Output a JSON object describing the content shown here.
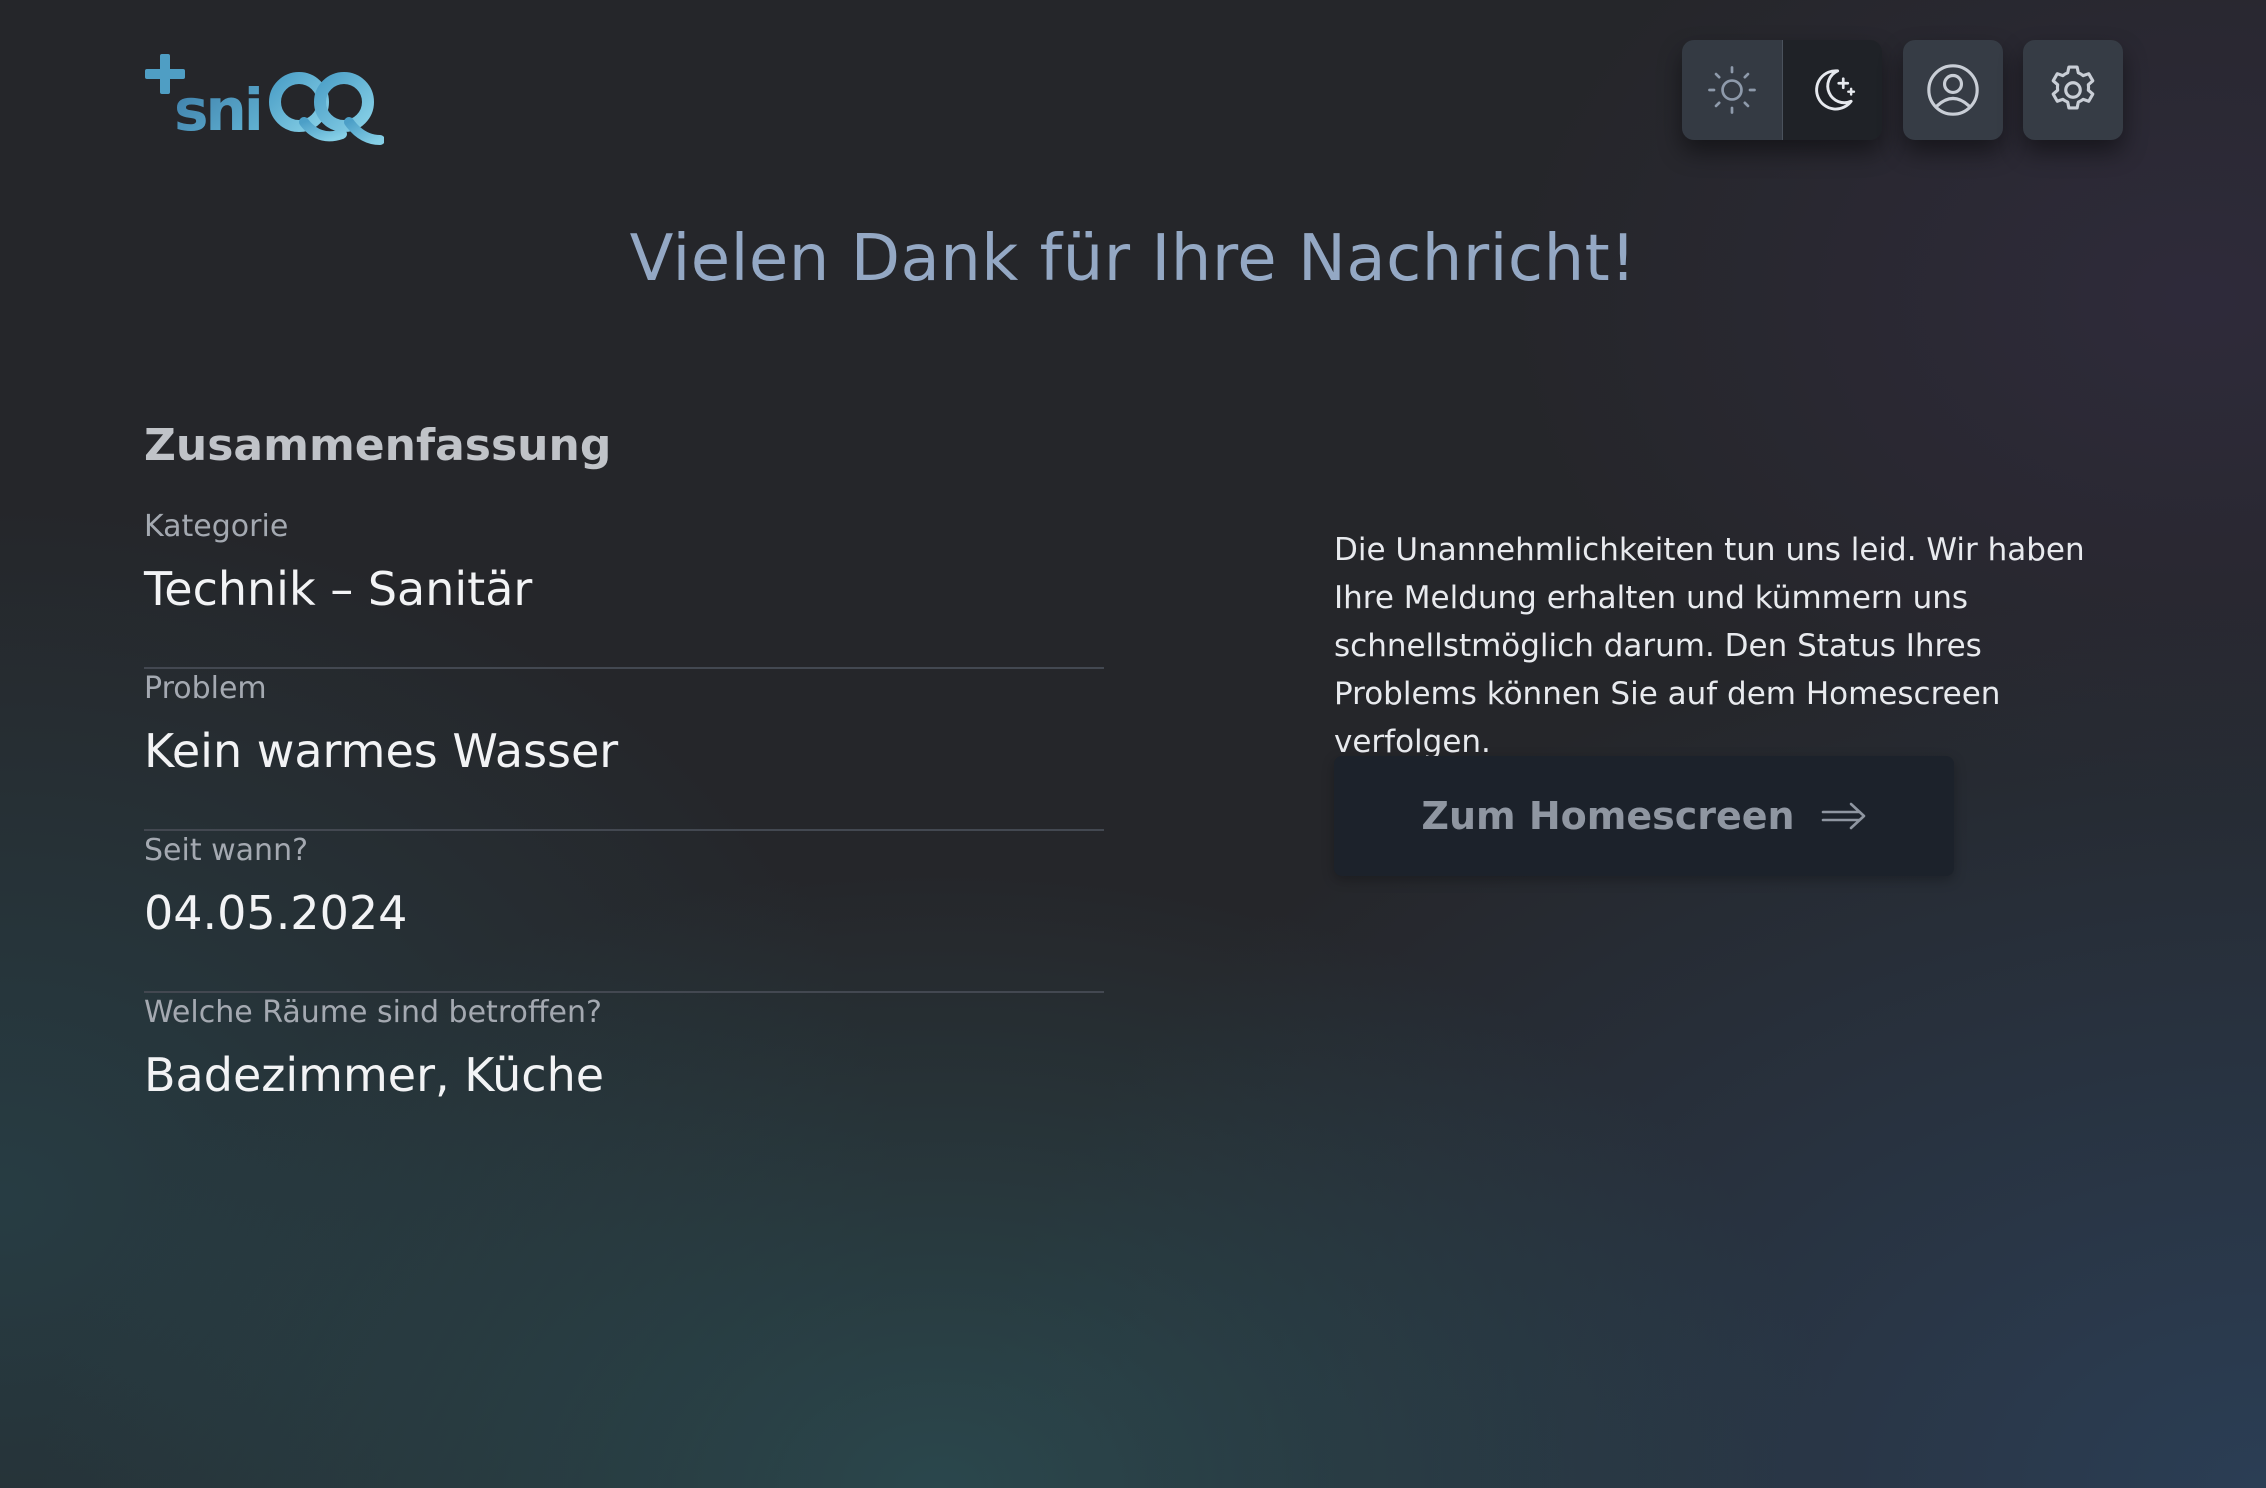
{
  "brand": {
    "logo_text": "sniQQ",
    "colors": {
      "primary": "#3f86a9",
      "accent": "#5fb4d6"
    }
  },
  "header": {
    "theme_toggle": {
      "light_icon": "sun-icon",
      "dark_icon": "moon-stars-icon",
      "active": "dark"
    },
    "profile_icon": "user-circle-icon",
    "settings_icon": "gear-icon"
  },
  "page": {
    "title": "Vielen Dank für Ihre Nachricht!"
  },
  "summary": {
    "heading": "Zusammenfassung",
    "items": [
      {
        "label": "Kategorie",
        "value": "Technik – Sanitär"
      },
      {
        "label": "Problem",
        "value": "Kein warmes Wasser"
      },
      {
        "label": "Seit wann?",
        "value": "04.05.2024"
      },
      {
        "label": "Welche Räume sind betroffen?",
        "value": "Badezimmer, Küche"
      }
    ]
  },
  "message": {
    "text": "Die Unannehmlichkeiten tun uns leid. Wir haben Ihre Meldung erhalten und kümmern uns schnellstmöglich darum. Den Status Ihres Problems können Sie auf dem Homescreen verfolgen."
  },
  "home_button": {
    "label": "Zum Homescreen",
    "icon": "arrow-right-icon"
  }
}
